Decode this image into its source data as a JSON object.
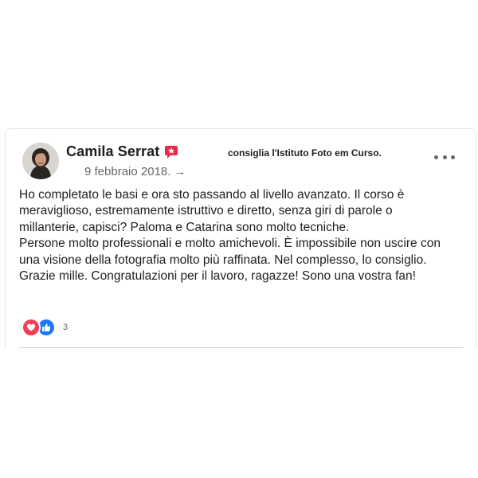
{
  "post": {
    "author": "Camila Serrat",
    "recommendation": "consiglia l'Istituto Foto em Curso.",
    "date": "9 febbraio 2018.",
    "date_arrow": "→",
    "body_lines": [
      "Ho completato le basi e ora sto passando al livello avanzato. Il corso è",
      "meraviglioso, estremamente istruttivo e diretto, senza giri di parole o",
      "millanterie, capisci? Paloma e Catarina sono molto tecniche.",
      "Persone molto professionali e molto amichevoli. È impossibile non uscire con",
      "una visione della fotografia molto più raffinata. Nel complesso, lo consiglio.",
      "Grazie mille. Congratulazioni per il lavoro, ragazze! Sono una vostra fan!"
    ],
    "reaction_count": "3"
  },
  "icons": {
    "avatar": "profile-photo",
    "recommend_badge": "recommend-badge-icon",
    "more": "more-options-icon",
    "love": "love-reaction-icon",
    "like": "like-reaction-icon"
  },
  "colors": {
    "text": "#1c1e21",
    "secondary_text": "#65676b",
    "recommend_badge": "#f02849",
    "love": "#f33e58",
    "like": "#2078f4"
  }
}
